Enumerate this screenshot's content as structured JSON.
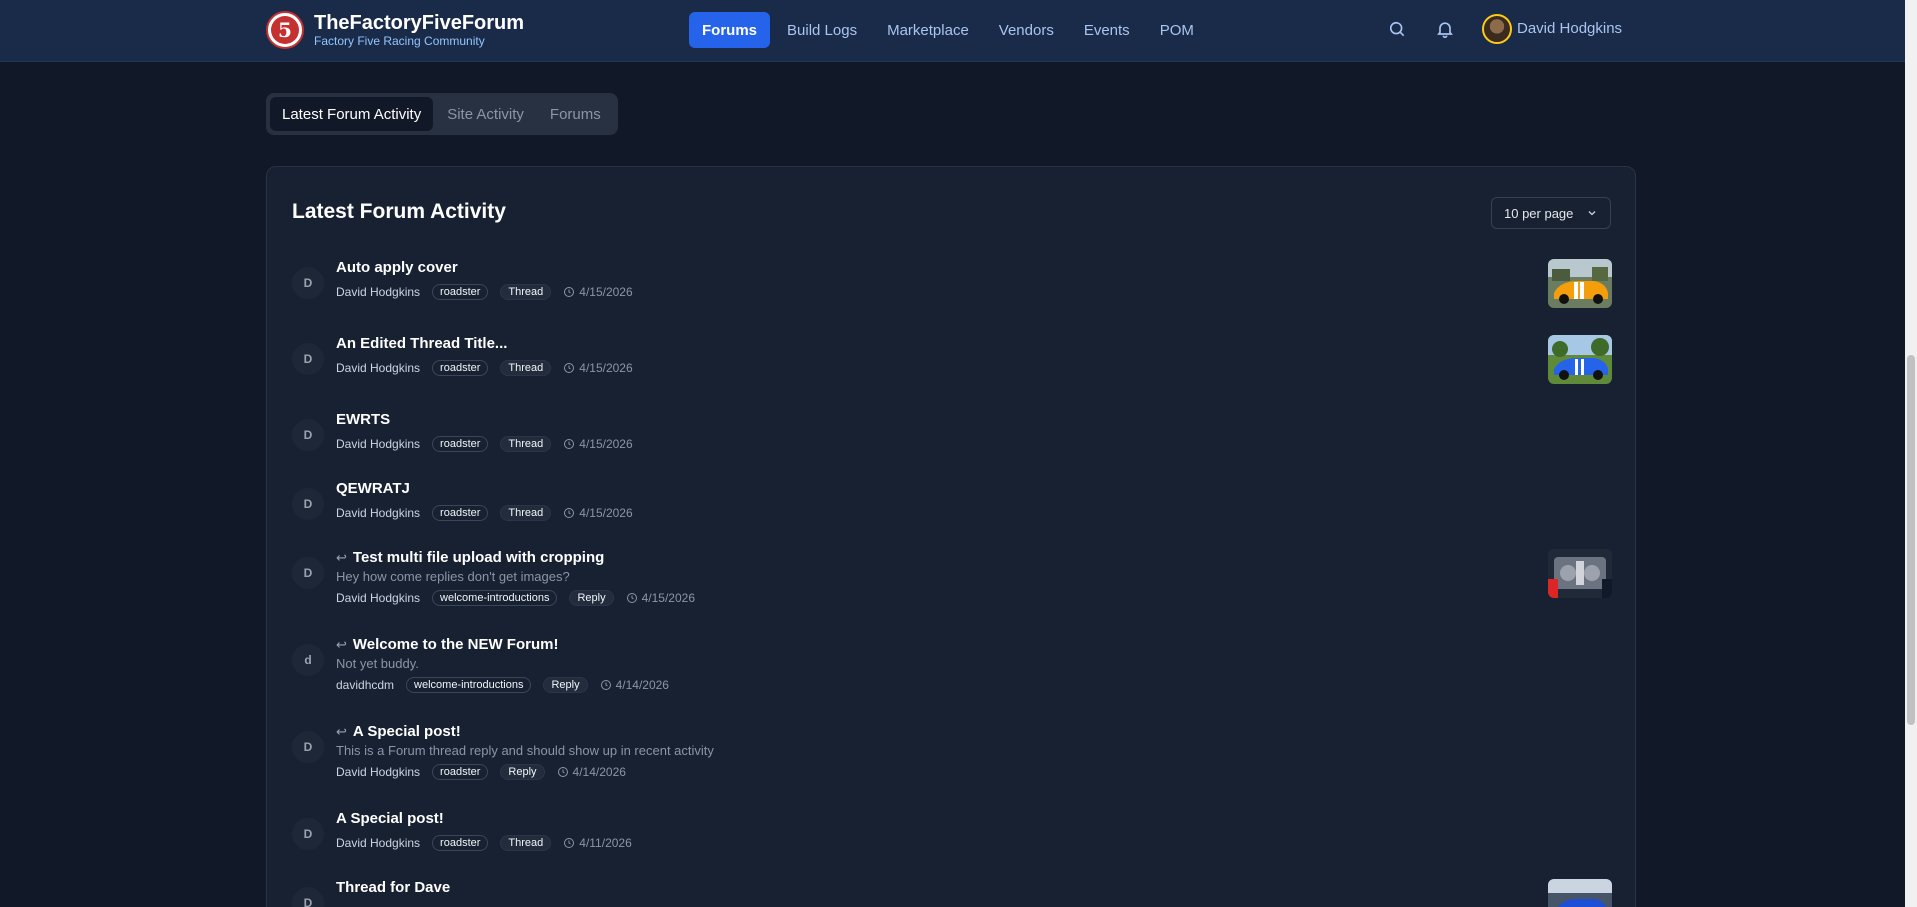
{
  "header": {
    "brand_title": "TheFactoryFiveForum",
    "brand_subtitle": "Factory Five Racing Community",
    "logo_text": "5",
    "nav": [
      {
        "label": "Forums",
        "active": true
      },
      {
        "label": "Build Logs"
      },
      {
        "label": "Marketplace"
      },
      {
        "label": "Vendors"
      },
      {
        "label": "Events"
      },
      {
        "label": "POM"
      }
    ],
    "user_name": "David Hodgkins",
    "icons": [
      "search-icon",
      "bell-icon"
    ]
  },
  "tabs": [
    {
      "label": "Latest Forum Activity",
      "active": true
    },
    {
      "label": "Site Activity"
    },
    {
      "label": "Forums"
    }
  ],
  "activity": {
    "title": "Latest Forum Activity",
    "per_page": "10 per page",
    "items": [
      {
        "avatar": "D",
        "title": "Auto apply cover",
        "author": "David Hodgkins",
        "forum": "roadster",
        "type": "Thread",
        "date": "4/15/2026",
        "thumb": "orange-car"
      },
      {
        "avatar": "D",
        "title": "An Edited Thread Title...",
        "author": "David Hodgkins",
        "forum": "roadster",
        "type": "Thread",
        "date": "4/15/2026",
        "thumb": "blue-car"
      },
      {
        "avatar": "D",
        "title": "EWRTS",
        "author": "David Hodgkins",
        "forum": "roadster",
        "type": "Thread",
        "date": "4/15/2026"
      },
      {
        "avatar": "D",
        "title": "QEWRATJ",
        "author": "David Hodgkins",
        "forum": "roadster",
        "type": "Thread",
        "date": "4/15/2026"
      },
      {
        "avatar": "D",
        "title": "Test multi file upload with cropping",
        "excerpt": "Hey how come replies don't get images?",
        "author": "David Hodgkins",
        "forum": "welcome-introductions",
        "type": "Reply",
        "date": "4/15/2026",
        "thumb": "engine"
      },
      {
        "avatar": "d",
        "title": "Welcome to the NEW Forum!",
        "excerpt": "Not yet buddy.",
        "author": "davidhcdm",
        "forum": "welcome-introductions",
        "type": "Reply",
        "date": "4/14/2026"
      },
      {
        "avatar": "D",
        "title": "A Special post!",
        "excerpt": "This is a Forum thread reply and should show up in recent activity",
        "author": "David Hodgkins",
        "forum": "roadster",
        "type": "Reply",
        "date": "4/14/2026"
      },
      {
        "avatar": "D",
        "title": "A Special post!",
        "author": "David Hodgkins",
        "forum": "roadster",
        "type": "Thread",
        "date": "4/11/2026"
      },
      {
        "avatar": "D",
        "title": "Thread for Dave",
        "thumb": "blue-car-2"
      }
    ]
  }
}
